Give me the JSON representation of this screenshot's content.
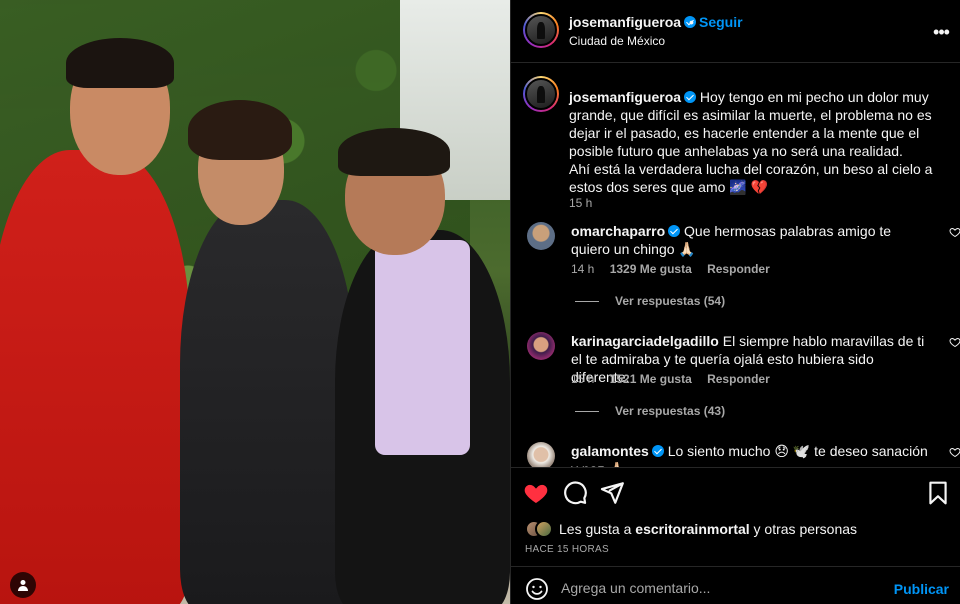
{
  "post": {
    "author": "josemanfigueroa",
    "follow_separator": "•",
    "follow_label": "Seguir",
    "location": "Ciudad de México",
    "more_label": "•••"
  },
  "caption": {
    "username": "josemanfigueroa",
    "text_1": "Hoy tengo en mi pecho un dolor muy grande, que difícil es asimilar la muerte, el problema no es dejar ir el pasado, es hacerle entender a la mente que el posible futuro que anhelabas ya no será una realidad.",
    "text_2": "Ahí está la verdadera lucha del corazón, un beso al cielo a estos dos seres que amo 🌌 💔",
    "time": "15 h"
  },
  "comments": [
    {
      "username": "omarchaparro",
      "text": "Que hermosas palabras amigo te quiero un chingo 🙏🏻",
      "time": "14 h",
      "likes": "1329 Me gusta",
      "reply_label": "Responder",
      "replies_label": "Ver respuestas (54)",
      "avatar_color": "#7a8aa0"
    },
    {
      "username": "karinagarciadelgadillo",
      "text": "El siempre hablo maravillas de ti el te admiraba y te quería ojalá esto hubiera sido diferente.",
      "time": "15 h",
      "likes": "1521 Me gusta",
      "reply_label": "Responder",
      "replies_label": "Ver respuestas (43)",
      "avatar_color": "#6a2a5a"
    },
    {
      "username": "galamontes",
      "text": "Lo siento mucho 😞 🕊️ te deseo sanación y paz 🙏🏻",
      "avatar_color": "#8c7a70"
    }
  ],
  "actions": {
    "liked": true,
    "heart_color": "#ff3040",
    "likes_prefix": "Les gusta a ",
    "likes_user": "escritorainmortal",
    "likes_suffix": " y otras personas",
    "time_ago": "HACE 15 HORAS"
  },
  "add_comment": {
    "placeholder": "Agrega un comentario...",
    "publish_label": "Publicar"
  }
}
